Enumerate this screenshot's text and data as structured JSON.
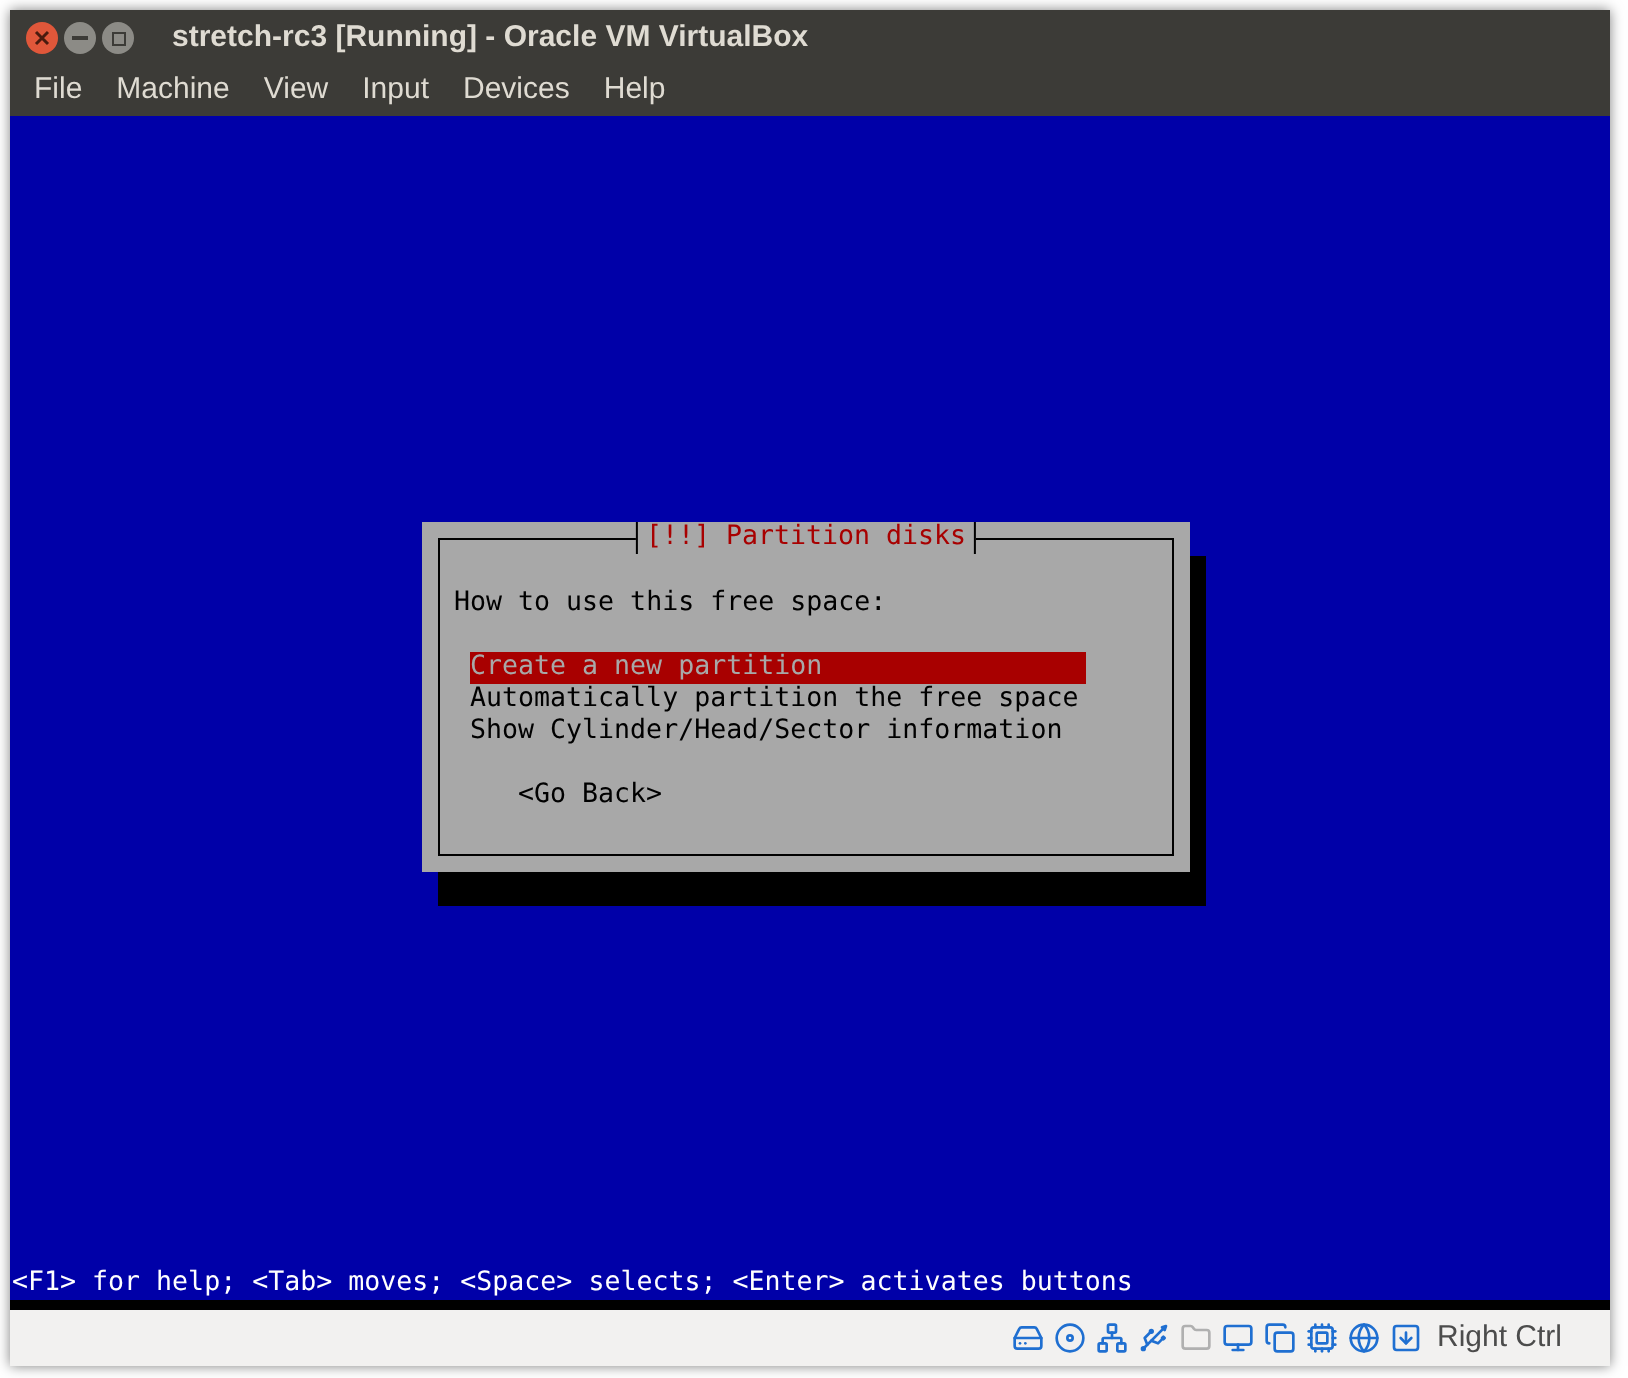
{
  "window": {
    "title": "stretch-rc3 [Running] - Oracle VM VirtualBox"
  },
  "menu": [
    "File",
    "Machine",
    "View",
    "Input",
    "Devices",
    "Help"
  ],
  "dialog": {
    "title": "[!!] Partition disks",
    "prompt": "How to use this free space:",
    "options": [
      {
        "label": "Create a new partition",
        "selected": true
      },
      {
        "label": "Automatically partition the free space",
        "selected": false
      },
      {
        "label": "Show Cylinder/Head/Sector information",
        "selected": false
      }
    ],
    "button": "<Go Back>"
  },
  "help_line": "<F1> for help; <Tab> moves; <Space> selects; <Enter> activates buttons",
  "status_bar": {
    "host_key": "Right Ctrl"
  }
}
